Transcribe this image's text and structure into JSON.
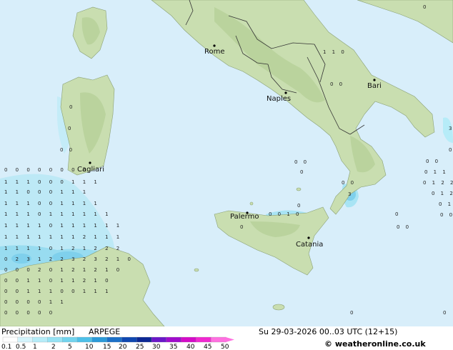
{
  "map": {
    "colors": {
      "sea": "#d8eefa",
      "land": "#c9deb0",
      "border": "#333333",
      "precip_light": "#a8e4f4",
      "precip_mid": "#7fd6ee"
    },
    "cities": [
      {
        "name": "Rome",
        "id": "rome"
      },
      {
        "name": "Naples",
        "id": "naples"
      },
      {
        "name": "Bari",
        "id": "bari"
      },
      {
        "name": "Cagliari",
        "id": "cagliari"
      },
      {
        "name": "Palermo",
        "id": "palermo"
      },
      {
        "name": "Catania",
        "id": "catania"
      }
    ]
  },
  "legend": {
    "title": "Precipitation [mm]",
    "model": "ARPEGE",
    "ticks": [
      "0.1",
      "0.5",
      "1",
      "2",
      "5",
      "10",
      "15",
      "20",
      "25",
      "30",
      "35",
      "40",
      "45",
      "50"
    ],
    "colors": [
      "#ffffff",
      "#d4f4fc",
      "#b6ecf8",
      "#96e2f4",
      "#72d4ee",
      "#4ec0e8",
      "#2c9ad8",
      "#1c70c8",
      "#1048b0",
      "#0c2894",
      "#6a18c8",
      "#a00ccc",
      "#d40cc8",
      "#f028d0",
      "#ff70e0"
    ]
  },
  "timestamp": "Su 29-03-2026 00..03 UTC (12+15)",
  "credit": "© weatheronline.co.uk"
}
